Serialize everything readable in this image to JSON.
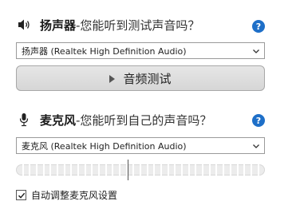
{
  "speaker": {
    "title": "扬声器",
    "question": " -您能听到测试声音吗？",
    "icon": "speaker-icon",
    "help_icon": "help-icon",
    "help_label": "?",
    "device": "扬声器 (Realtek High Definition Audio)",
    "test_button_label": "音频测试"
  },
  "microphone": {
    "title": "麦克风",
    "question": "-您能听到自己的声音吗？",
    "icon": "microphone-icon",
    "help_icon": "help-icon",
    "help_label": "?",
    "device": "麦克风 (Realtek High Definition Audio)",
    "level": 0.45
  },
  "auto_adjust": {
    "label": "自动调整麦克风设置",
    "checked": true
  },
  "colors": {
    "help_bg": "#1e6fc8",
    "meter_track": "#ececec"
  }
}
